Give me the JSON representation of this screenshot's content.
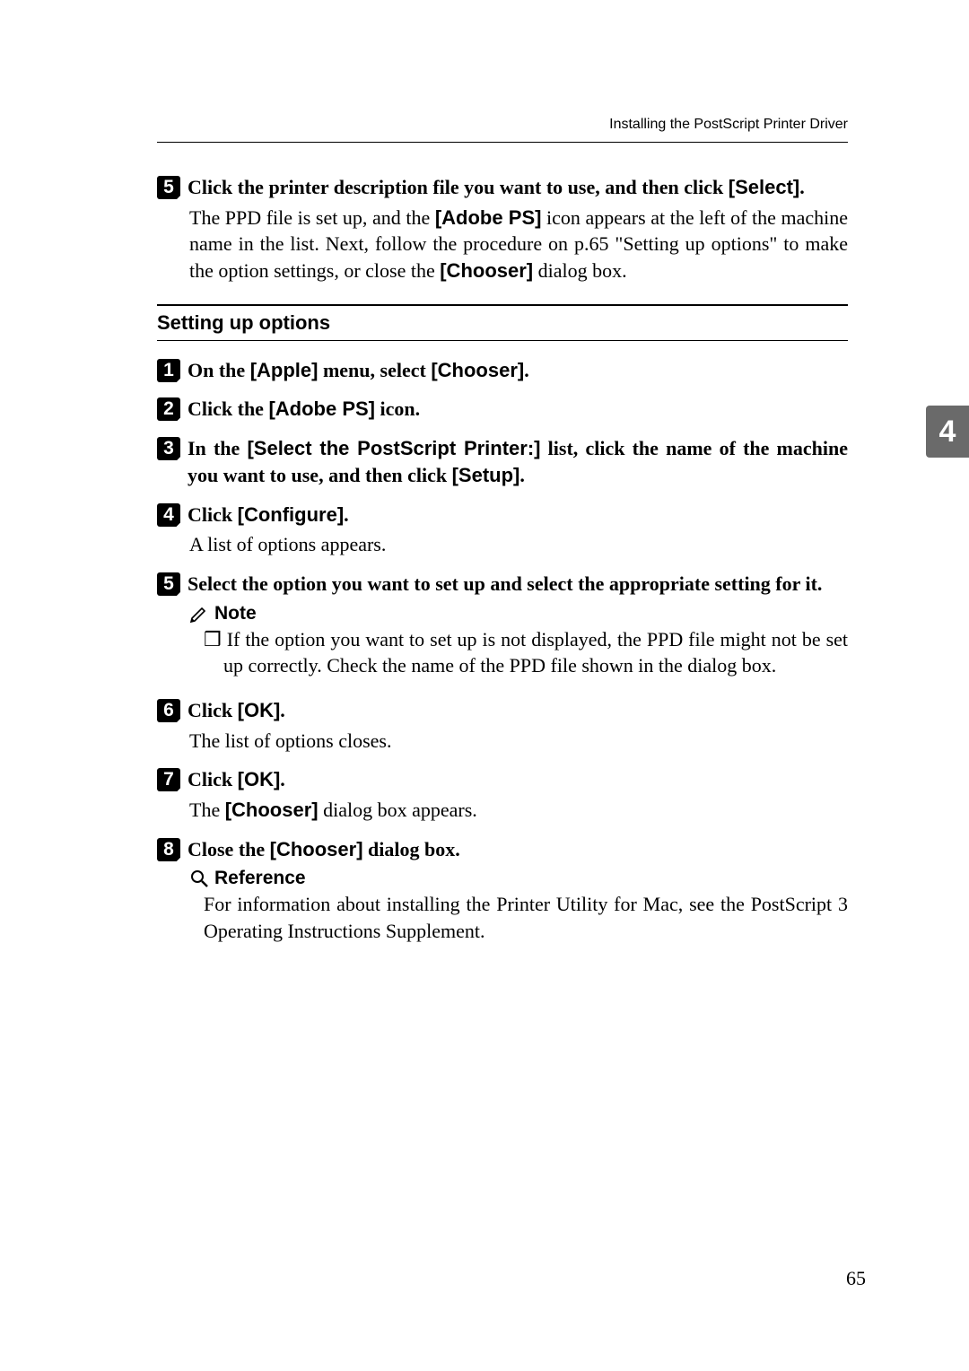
{
  "header": {
    "title": "Installing the PostScript Printer Driver"
  },
  "top_step": {
    "num": "5",
    "title_prefix": "Click the printer description file you want to use, and then click ",
    "title_ui": "[Select]",
    "title_suffix": ".",
    "body_p1": "The PPD file is set up, and the ",
    "body_ui1": "[Adobe PS]",
    "body_p2": " icon appears at the left of the machine name in the list. Next, follow the procedure on p.65 \"Setting up options\" to make the option settings, or close the ",
    "body_ui2": "[Chooser]",
    "body_p3": " dialog box."
  },
  "section": {
    "title": "Setting up options"
  },
  "steps": [
    {
      "num": "1",
      "title_parts": [
        "On the ",
        "[Apple]",
        " menu, select ",
        "[Chooser]",
        "."
      ]
    },
    {
      "num": "2",
      "title_parts": [
        "Click the ",
        "[Adobe PS]",
        " icon."
      ]
    },
    {
      "num": "3",
      "title_parts": [
        "In the ",
        "[Select the PostScript Printer:]",
        " list, click the name of the machine you want to use, and then click ",
        "[Setup]",
        "."
      ]
    },
    {
      "num": "4",
      "title_parts": [
        "Click ",
        "[Configure]",
        "."
      ],
      "body": "A list of options appears."
    },
    {
      "num": "5",
      "title_parts": [
        "Select the option you want to set up and select the appropriate setting for it."
      ],
      "note_label": "Note",
      "note_bullet": "❒",
      "note_body": "If the option you want to set up is not displayed, the PPD file might not be set up correctly. Check the name of the PPD file shown in the dialog box."
    },
    {
      "num": "6",
      "title_parts": [
        "Click ",
        "[OK]",
        "."
      ],
      "body": "The list of options closes."
    },
    {
      "num": "7",
      "title_parts": [
        "Click ",
        "[OK]",
        "."
      ],
      "body_parts": [
        "The ",
        "[Chooser]",
        " dialog box appears."
      ]
    },
    {
      "num": "8",
      "title_parts": [
        "Close the ",
        "[Chooser]",
        " dialog box."
      ],
      "ref_label": "Reference",
      "ref_body": "For information about installing the Printer Utility for Mac, see the PostScript 3 Operating Instructions Supplement."
    }
  ],
  "sidebar": {
    "tab": "4"
  },
  "footer": {
    "page": "65"
  }
}
